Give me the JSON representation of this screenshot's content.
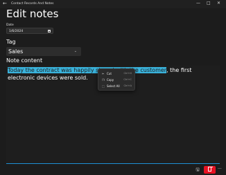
{
  "window": {
    "title": "Contact Records And Notes",
    "back_glyph": "←",
    "minimize_glyph": "—",
    "maximize_glyph": "□",
    "close_glyph": "✕"
  },
  "page": {
    "title": "Edit notes"
  },
  "date": {
    "label": "Date",
    "value": "1/6/2024",
    "icon": "calendar-icon"
  },
  "tag": {
    "label": "Tag",
    "value": "Sales",
    "icon": "chevron-down-icon",
    "chevron_glyph": "⌄"
  },
  "note": {
    "label": "Note content",
    "selected_text": "Today the contract was happily signed with the customer",
    "rest_text": ", the first electronic devices were sold."
  },
  "context_menu": {
    "items": [
      {
        "label": "Cut",
        "shortcut": "Ctrl+X",
        "icon": "cut-icon",
        "glyph": "✂"
      },
      {
        "label": "Copy",
        "shortcut": "Ctrl+C",
        "icon": "copy-icon",
        "glyph": "❐"
      },
      {
        "label": "Select All",
        "shortcut": "Ctrl+A",
        "icon": "select-all-icon",
        "glyph": "⬚"
      }
    ]
  },
  "commands": {
    "save_glyph": "🖫",
    "more_glyph": "···",
    "delete_color": "#e81123"
  },
  "colors": {
    "accent": "#1e90d6",
    "selection": "#3ab3dc",
    "background": "#1c1c1c"
  }
}
